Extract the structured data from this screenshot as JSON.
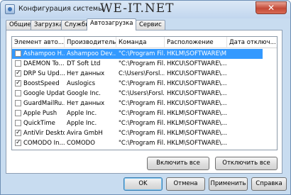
{
  "window": {
    "title": "Конфигурация системы",
    "watermark": "WE-IT.NET",
    "close_label": "✕"
  },
  "tabs": [
    {
      "label": "Общие"
    },
    {
      "label": "Загрузка"
    },
    {
      "label": "Службы"
    },
    {
      "label": "Автозагрузка",
      "active": true
    },
    {
      "label": "Сервис"
    }
  ],
  "startup_table": {
    "columns": [
      "Элемент авто...",
      "Производитель",
      "Команда",
      "Расположение",
      "Дата отключ..."
    ],
    "rows": [
      {
        "checked": false,
        "selected": true,
        "item": "Ashampoo H...",
        "manufacturer": "Ashampoo Dev...",
        "command": "\"C:\\Program Fil...",
        "location": "HKLM\\SOFTWARE\\M...",
        "date": ""
      },
      {
        "checked": false,
        "selected": false,
        "item": "DAEMON To...",
        "manufacturer": "DT Soft Ltd",
        "command": "\"C:\\Program Fil...",
        "location": "HKCU\\SOFTWARE\\...",
        "date": ""
      },
      {
        "checked": true,
        "selected": false,
        "item": "DRP Su Upd...",
        "manufacturer": "Нет данных",
        "command": "C:\\Users\\Forsl...",
        "location": "HKCU\\SOFTWARE\\...",
        "date": ""
      },
      {
        "checked": true,
        "selected": false,
        "item": "BoostSpeed",
        "manufacturer": "Auslogics",
        "command": "\"C:\\Program Fil...",
        "location": "HKCU\\SOFTWARE\\...",
        "date": ""
      },
      {
        "checked": false,
        "selected": false,
        "item": "Google Update",
        "manufacturer": "Google Inc.",
        "command": "\"C:\\Users\\Forsl...",
        "location": "HKCU\\SOFTWARE\\...",
        "date": ""
      },
      {
        "checked": false,
        "selected": false,
        "item": "GuardMailRu...",
        "manufacturer": "Нет данных",
        "command": "\"C:\\Program Fil...",
        "location": "HKCU\\SOFTWARE\\...",
        "date": ""
      },
      {
        "checked": false,
        "selected": false,
        "item": "Apple Push",
        "manufacturer": "Apple Inc.",
        "command": "\"C:\\Program Fil...",
        "location": "HKLM\\SOFTWARE\\...",
        "date": ""
      },
      {
        "checked": false,
        "selected": false,
        "item": "QuickTime",
        "manufacturer": "Apple Inc.",
        "command": "\"C:\\Program Fil...",
        "location": "HKLM\\SOFTWARE\\...",
        "date": ""
      },
      {
        "checked": true,
        "selected": false,
        "item": "AntiVir Desktop",
        "manufacturer": "Avira GmbH",
        "command": "\"C:\\Program Fil...",
        "location": "HKLM\\SOFTWARE\\...",
        "date": ""
      },
      {
        "checked": true,
        "selected": false,
        "item": "COMODO In...",
        "manufacturer": "COMODO",
        "command": "\"C:\\Program Fil...",
        "location": "HKLM\\SOFTWARE\\...",
        "date": ""
      }
    ]
  },
  "panel_buttons": {
    "enable_all": "Включить все",
    "disable_all": "Отключить все"
  },
  "dialog_buttons": {
    "ok": "OK",
    "cancel": "Отмена",
    "apply": "Применить",
    "help": "Справка"
  },
  "colors": {
    "selection": "#3399ff",
    "close_button": "#c44a37",
    "window_frame": "#c8dcf0"
  }
}
